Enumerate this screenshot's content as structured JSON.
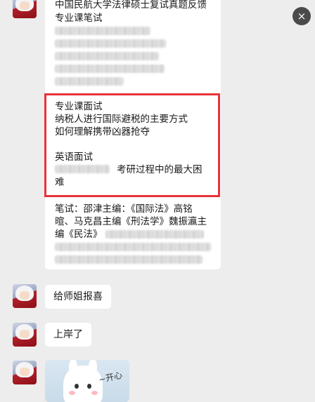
{
  "messages": {
    "first": {
      "title": "中国民航大学法律硕士复试真题反馈",
      "written_heading": "专业课笔试",
      "interview_heading": "专业课面试",
      "interview_q1": "纳税人进行国际避税的主要方式",
      "interview_q2": "如何理解携带凶器抢夺",
      "english_heading": "英语面试",
      "english_q": "考研过程中的最大困",
      "english_q_cont": "难",
      "books_line1": "笔试：邵津主编：《国际法》高铭",
      "books_line2": "暄、马克昌主编《刑法学》魏振瀛主",
      "books_line3": "编《民法》"
    },
    "second": {
      "text": "给师姐报喜"
    },
    "third": {
      "text": "上岸了"
    },
    "sticker": {
      "caption": "~开心"
    }
  },
  "controls": {
    "close_icon": "×"
  },
  "colors": {
    "highlight_border": "#e8323c",
    "bubble": "#ffffff",
    "background": "#ededed"
  }
}
